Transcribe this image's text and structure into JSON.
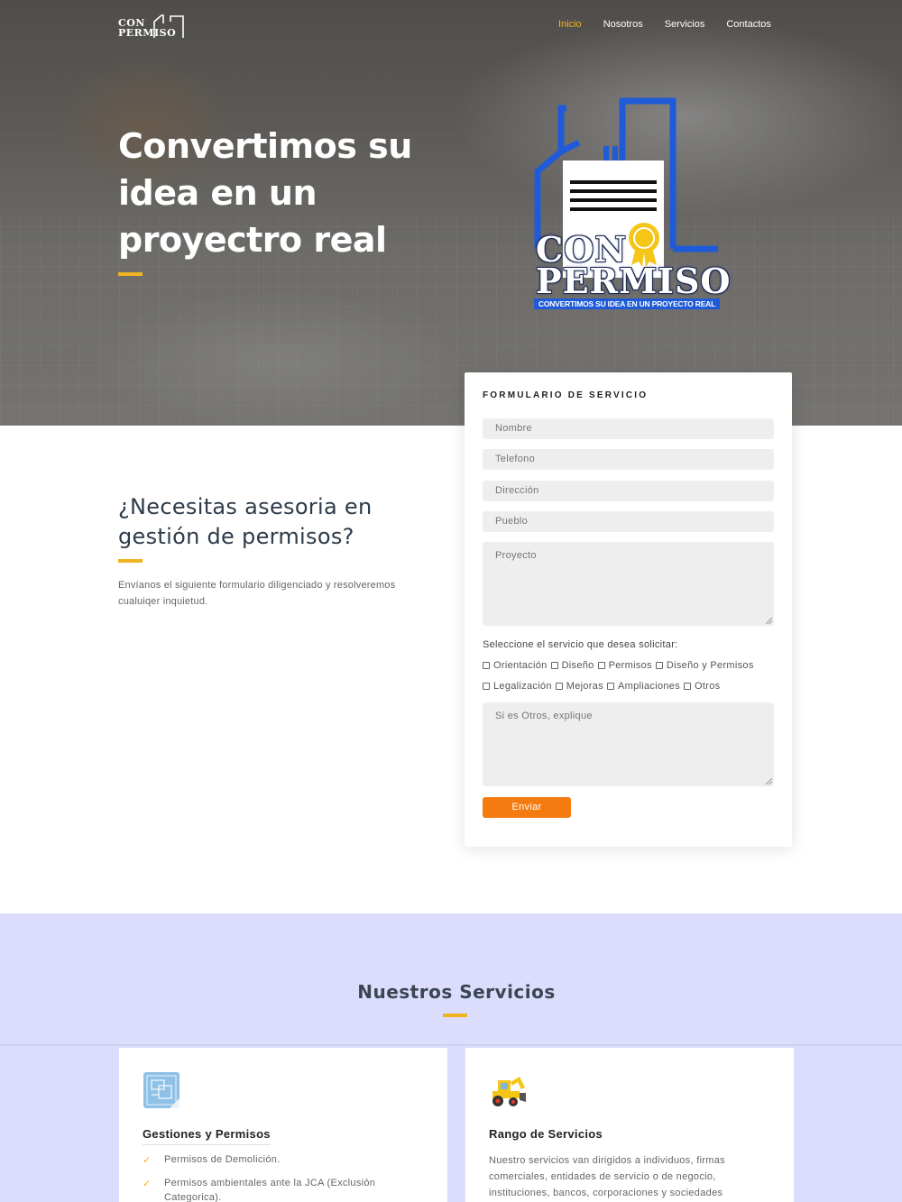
{
  "nav": {
    "brand_line1": "CON",
    "brand_line2": "PERMISO",
    "items": [
      {
        "label": "Inicio",
        "active": true
      },
      {
        "label": "Nosotros",
        "active": false
      },
      {
        "label": "Servicios",
        "active": false
      },
      {
        "label": "Contactos",
        "active": false
      }
    ]
  },
  "hero": {
    "title": "Convertimos su idea en un proyectro real",
    "logo_line1": "CON",
    "logo_line2": "PERMISO",
    "logo_tagline": "CONVERTIMOS SU IDEA EN UN PROYECTO REAL"
  },
  "intro": {
    "title": "¿Necesitas asesoria en gestión de permisos?",
    "text": "Envíanos el siguiente formulario diligenciado y resolveremos cualuiqer inquietud."
  },
  "form": {
    "title": "FORMULARIO DE SERVICIO",
    "nombre_placeholder": "Nombre",
    "telefono_placeholder": "Telefono",
    "direccion_placeholder": "Dirección",
    "pueblo_placeholder": "Pueblo",
    "proyecto_placeholder": "Proyecto",
    "select_label": "Seleccione el servicio que desea solicitar:",
    "options_row1": [
      "Orientación",
      "Diseño",
      "Permisos",
      "Diseño y Permisos"
    ],
    "options_row2": [
      "Legalización",
      "Mejoras",
      "Ampliaciones",
      "Otros"
    ],
    "otros_placeholder": "Si es Otros, explique",
    "submit_label": "Enviar"
  },
  "services": {
    "title": "Nuestros Servicios",
    "cards": [
      {
        "name": "Gestiones y Permisos",
        "icon": "blueprint-icon",
        "items": [
          "Permisos de Demolición.",
          "Permisos ambientales ante la JCA (Exclusión Categorica)."
        ]
      },
      {
        "name": "Rango de Servicios",
        "icon": "excavator-icon",
        "description": "Nuestro servicios van dirigidos a individuos, firmas comerciales, entidades de servicio o de negocio, instituciones, bancos, corporaciones y sociedades"
      }
    ]
  },
  "colors": {
    "accent_yellow": "#f2b321",
    "button_orange": "#f47b10",
    "services_bg": "#dcdcfc",
    "logo_blue": "#1f5bd8"
  }
}
